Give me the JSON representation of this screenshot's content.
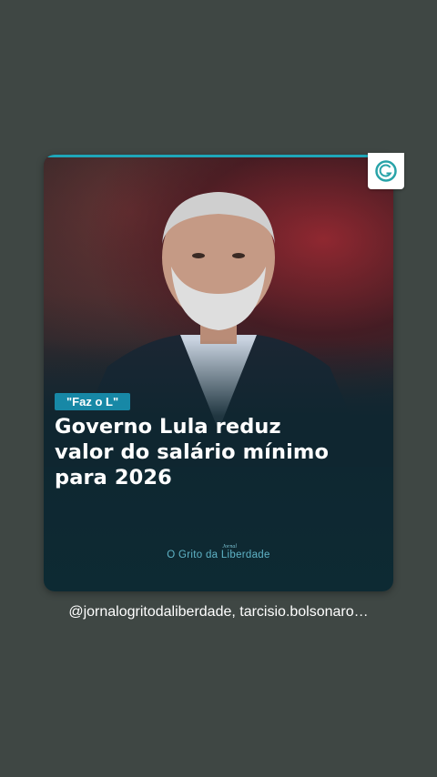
{
  "post": {
    "tag": "\"Faz o L\"",
    "headline_lines": [
      "Governo Lula reduz",
      "valor do salário mínimo",
      "para 2026"
    ],
    "brand_small": "Jornal",
    "brand_name": "O Grito da Liberdade",
    "logo_icon": "g-logo-icon"
  },
  "caption": "@jornalogritodaliberdade, tarcisio.bolsonaro…",
  "colors": {
    "background": "#3f4744",
    "accent": "#1788a6",
    "brand": "#5fb3c6"
  }
}
